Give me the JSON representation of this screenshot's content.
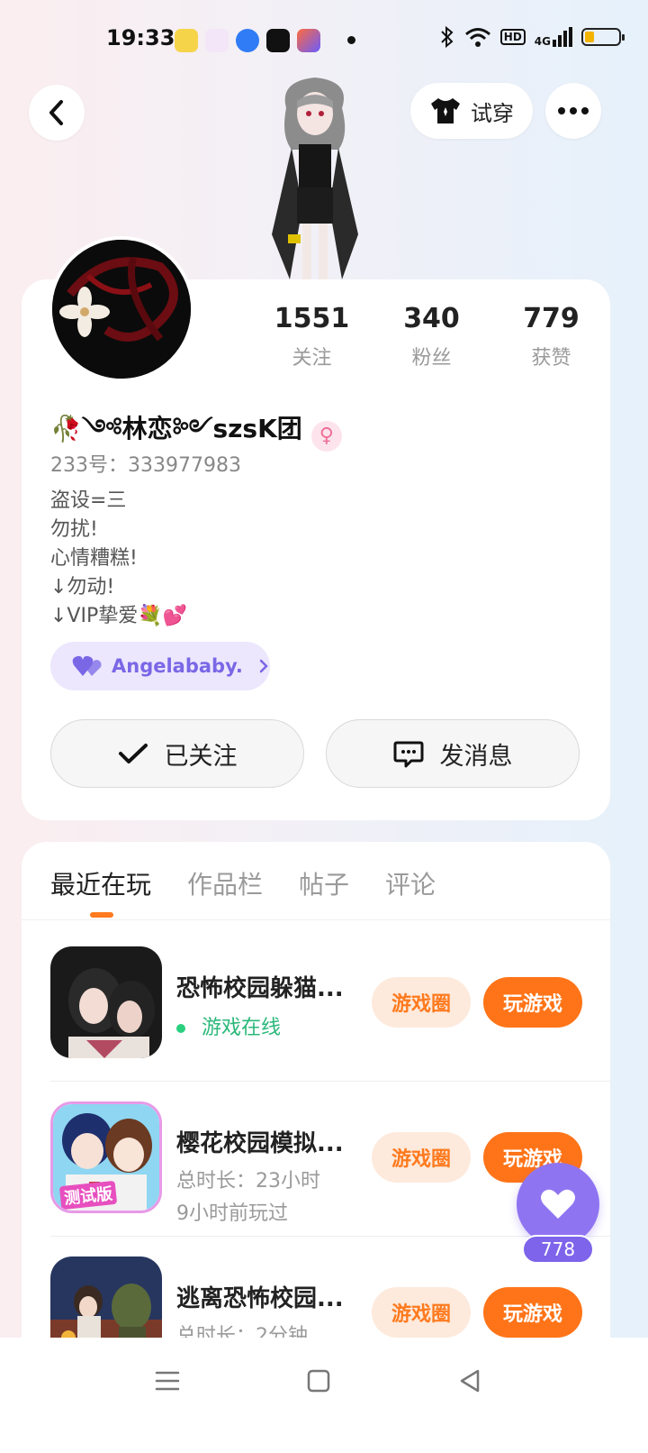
{
  "status_bar": {
    "time": "19:33",
    "network_label": "4G",
    "hd_label": "HD"
  },
  "header": {
    "tryon_label": "试穿"
  },
  "profile": {
    "stats": [
      {
        "value": "1551",
        "label": "关注"
      },
      {
        "value": "340",
        "label": "粉丝"
      },
      {
        "value": "779",
        "label": "获赞"
      }
    ],
    "nickname": "🥀༺林恋༻szsK团",
    "gender_symbol": "♀",
    "uid": "233号：333977983",
    "bio": [
      "盗设=三",
      "勿扰!",
      "心情糟糕!",
      "↓勿动!",
      "↓VIP挚爱💐💕"
    ],
    "friend_tag": "Angelababy.",
    "follow_label": "已关注",
    "message_label": "发消息"
  },
  "tabs": [
    {
      "label": "最近在玩",
      "active": true
    },
    {
      "label": "作品栏",
      "active": false
    },
    {
      "label": "帖子",
      "active": false
    },
    {
      "label": "评论",
      "active": false
    }
  ],
  "games": [
    {
      "title": "恐怖校园躲猫...",
      "line1": "游戏在线",
      "line2": "",
      "circle_label": "游戏圈",
      "play_label": "玩游戏"
    },
    {
      "title": "樱花校园模拟...",
      "line1": "总时长：23小时",
      "line2": "9小时前玩过",
      "circle_label": "游戏圈",
      "play_label": "玩游戏",
      "badge": "测试版"
    },
    {
      "title": "逃离恐怖校园...",
      "line1": "总时长：2分钟",
      "line2": "",
      "circle_label": "游戏圈",
      "play_label": "玩游戏"
    }
  ],
  "like_count": "778",
  "colors": {
    "accent_orange": "#ff7418",
    "accent_purple": "#8f74f2",
    "online_green": "#2bb87a"
  }
}
